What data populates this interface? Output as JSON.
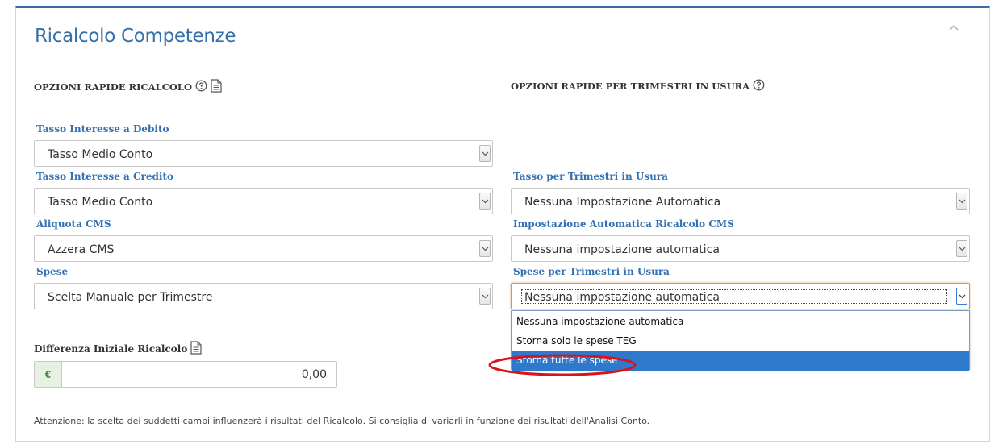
{
  "title": "Ricalcolo Competenze",
  "sections": {
    "left_heading": "OPZIONI RAPIDE RICALCOLO",
    "right_heading": "OPZIONI RAPIDE PER TRIMESTRI IN USURA"
  },
  "left": {
    "tasso_debito": {
      "label": "Tasso Interesse a Debito",
      "value": "Tasso Medio Conto"
    },
    "tasso_credito": {
      "label": "Tasso Interesse a Credito",
      "value": "Tasso Medio Conto"
    },
    "aliquota_cms": {
      "label": "Aliquota CMS",
      "value": "Azzera CMS"
    },
    "spese": {
      "label": "Spese",
      "value": "Scelta Manuale per Trimestre"
    }
  },
  "right": {
    "tasso_usura": {
      "label": "Tasso per Trimestri in Usura",
      "value": "Nessuna Impostazione Automatica"
    },
    "cms_auto": {
      "label": "Impostazione Automatica Ricalcolo CMS",
      "value": "Nessuna impostazione automatica"
    },
    "spese_usura": {
      "label": "Spese per Trimestri in Usura",
      "value": "Nessuna impostazione automatica"
    }
  },
  "dropdown": {
    "options": [
      "Nessuna impostazione automatica",
      "Storna solo le spese TEG",
      "Storna tutte le spese"
    ],
    "highlighted_index": 2
  },
  "differenza": {
    "label": "Differenza Iniziale Ricalcolo",
    "currency": "€",
    "value": "0,00"
  },
  "note": "Attenzione: la scelta dei suddetti campi influenzerà i risultati del Ricalcolo. Si consiglia di variarli in funzione dei risultati dell'Analisi Conto.",
  "colors": {
    "accent": "#3670a9",
    "label_blue": "#3571b0",
    "selected_option": "#2f79cc",
    "annotation_red": "#d9141b"
  }
}
